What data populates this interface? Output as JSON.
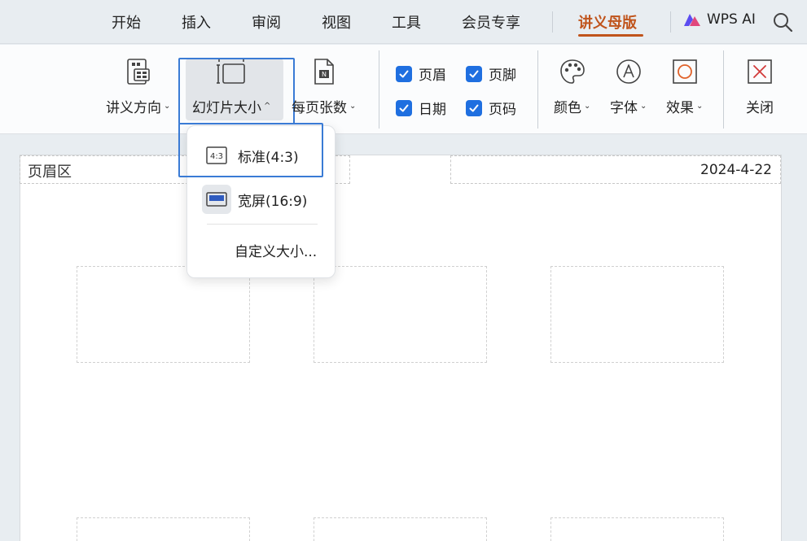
{
  "tabs": [
    {
      "label": "开始"
    },
    {
      "label": "插入"
    },
    {
      "label": "审阅"
    },
    {
      "label": "视图"
    },
    {
      "label": "工具"
    },
    {
      "label": "会员专享"
    },
    {
      "label": "讲义母版",
      "active": true
    }
  ],
  "wps_ai": {
    "label": "WPS AI"
  },
  "ribbon": {
    "handout_orientation": "讲义方向",
    "slide_size": "幻灯片大小",
    "per_page": "每页张数",
    "checkboxes": {
      "header": "页眉",
      "footer": "页脚",
      "date": "日期",
      "page_number": "页码"
    },
    "colors": "颜色",
    "fonts": "字体",
    "effects": "效果",
    "close": "关闭",
    "per_page_icon_text": "N"
  },
  "dropdown": {
    "standard": "标准(4:3)",
    "standard_icon_text": "4:3",
    "widescreen": "宽屏(16:9)",
    "custom": "自定义大小..."
  },
  "canvas": {
    "header_label": "页眉区",
    "date": "2024-4-22"
  },
  "colors": {
    "accent": "#c0541c",
    "highlight": "#3a7bd5",
    "checkbox": "#1f6fe0",
    "close_icon": "#d23a3a",
    "effects_icon": "#e0622a"
  }
}
